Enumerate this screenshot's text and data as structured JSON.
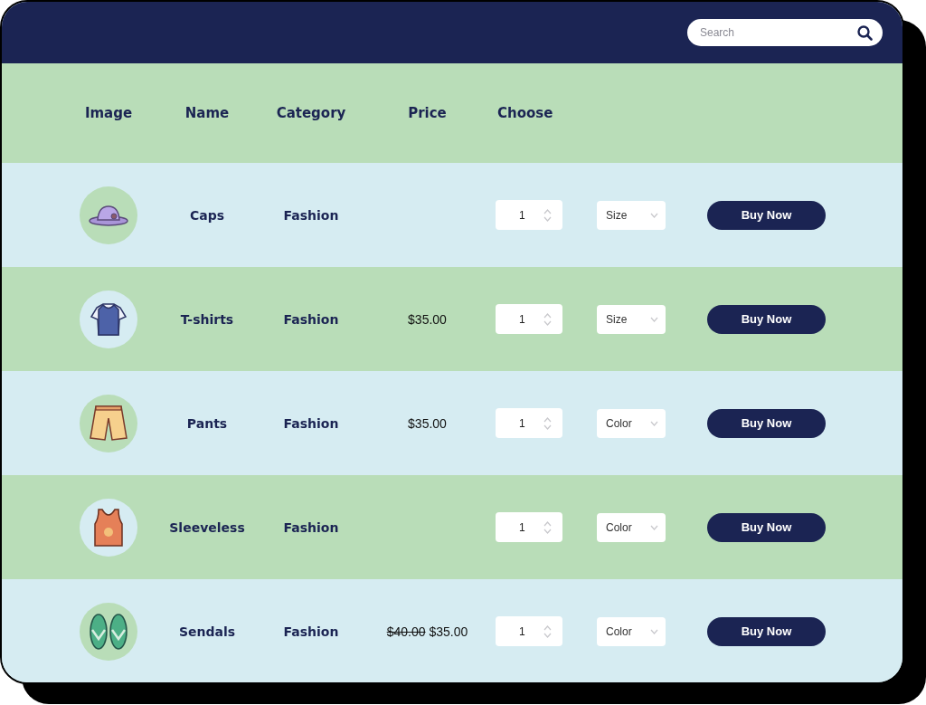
{
  "search": {
    "placeholder": "Search"
  },
  "table": {
    "columns": [
      "Image",
      "Name",
      "Category",
      "Price",
      "Choose"
    ],
    "rows": [
      {
        "name": "Caps",
        "category": "Fashion",
        "quantity": "1",
        "option": "Size",
        "button": "Buy Now"
      },
      {
        "name": "T-shirts",
        "category": "Fashion",
        "price": "$35.00",
        "quantity": "1",
        "option": "Size",
        "button": "Buy Now"
      },
      {
        "name": "Pants",
        "category": "Fashion",
        "price": "$35.00",
        "quantity": "1",
        "option": "Color",
        "button": "Buy Now"
      },
      {
        "name": "Sleeveless",
        "category": "Fashion",
        "quantity": "1",
        "option": "Color",
        "button": "Buy Now"
      },
      {
        "name": "Sendals",
        "category": "Fashion",
        "old_price": "$40.00",
        "price": "$35.00",
        "quantity": "1",
        "option": "Color",
        "button": "Buy Now"
      }
    ]
  }
}
